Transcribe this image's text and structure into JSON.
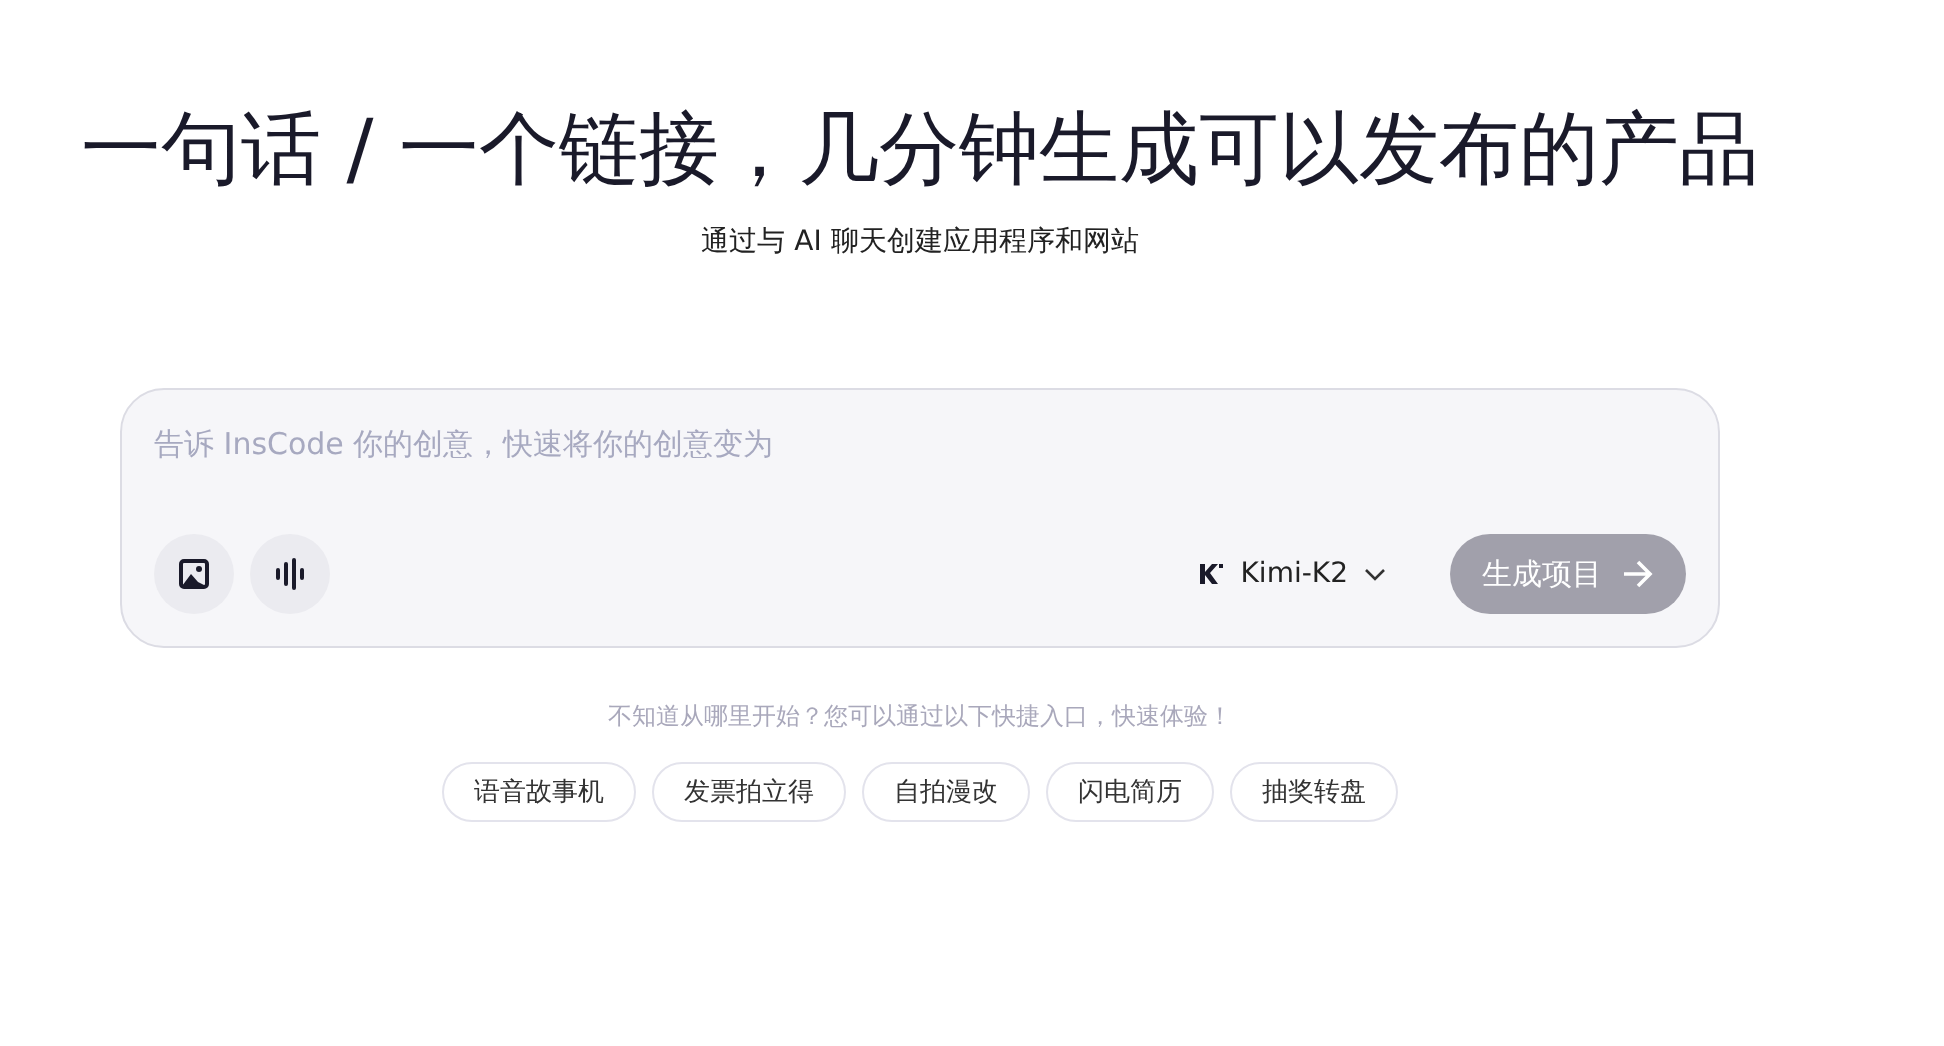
{
  "headline": "一句话 / 一个链接，几分钟生成可以发布的产品",
  "subtitle": "通过与 AI 聊天创建应用程序和网站",
  "prompt": {
    "placeholder": "告诉 InsCode 你的创意，快速将你的创意变为",
    "model": "Kimi-K2",
    "submit": {
      "label": "生成项目",
      "disabled": true
    }
  },
  "hint": "不知道从哪里开始？您可以通过以下快捷入口，快速体验！",
  "shortcuts": [
    "语音故事机",
    "发票拍立得",
    "自拍漫改",
    "闪电简历",
    "抽奖转盘"
  ]
}
